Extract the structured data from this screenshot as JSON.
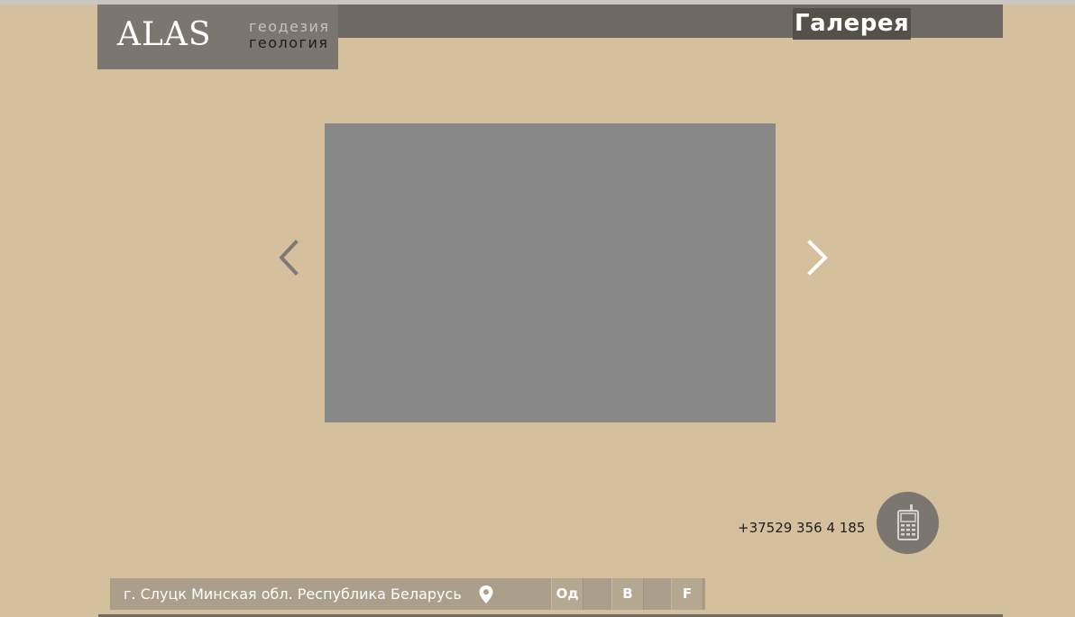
{
  "logo": {
    "main": "ALAS",
    "line1": "геодезия",
    "line2": "геология"
  },
  "header": {
    "title": "Галерея"
  },
  "gallery": {
    "image_alt": "surveyors-with-total-station-photo",
    "prev_icon": "chevron-left-icon",
    "next_icon": "chevron-right-icon"
  },
  "contact": {
    "phone": "+37529 356 4 185",
    "phone_icon": "mobile-phone-icon"
  },
  "footer": {
    "address": "г. Слуцк Минская обл. Республика Беларусь",
    "pin_icon": "map-pin-icon",
    "social": {
      "ok": "Од",
      "vk": "В",
      "fb": "F"
    }
  },
  "colors": {
    "background": "#d5c09d",
    "header": "#6e6a63",
    "logo_block": "#7b766f",
    "footer": "#ab9e8a"
  }
}
